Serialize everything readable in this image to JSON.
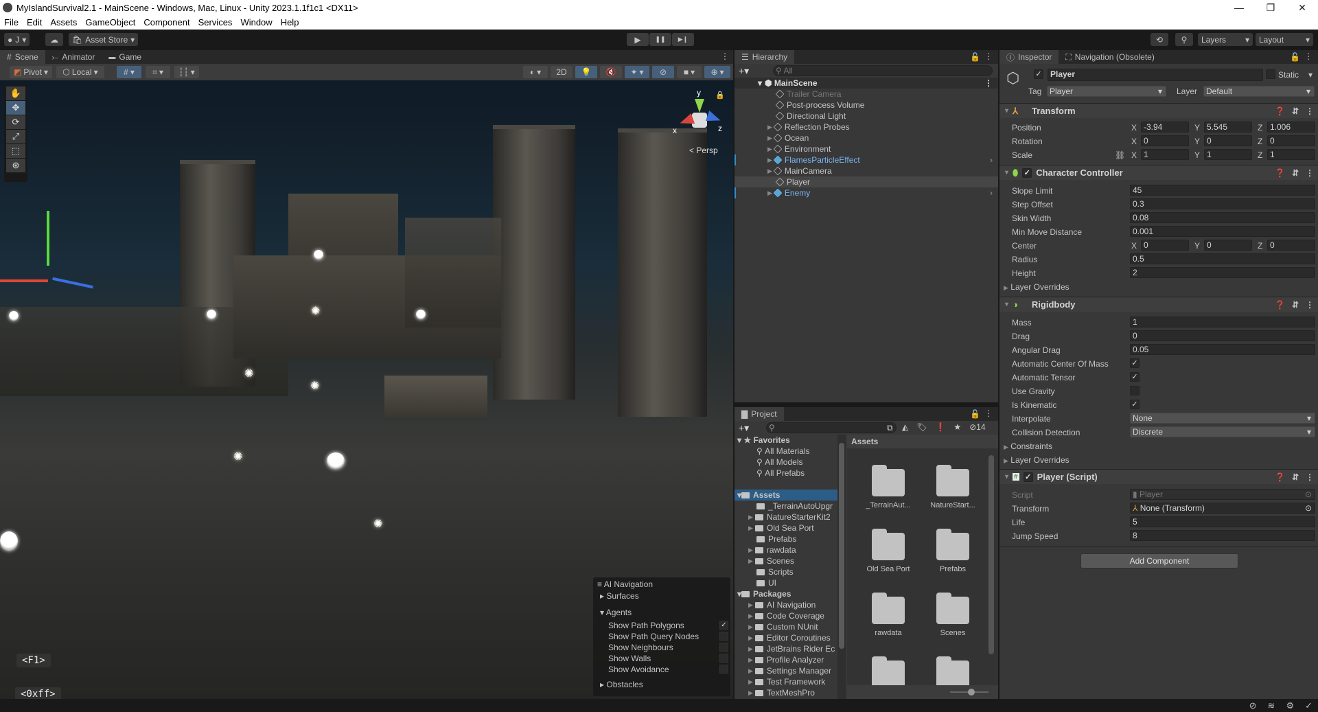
{
  "window": {
    "title": "MyIslandSurvival2.1 - MainScene - Windows, Mac, Linux - Unity 2023.1.1f1c1 <DX11>",
    "controls": {
      "minimize": "—",
      "restore": "❐",
      "close": "✕"
    }
  },
  "menu": [
    "File",
    "Edit",
    "Assets",
    "GameObject",
    "Component",
    "Services",
    "Window",
    "Help"
  ],
  "toolbar": {
    "account": "J",
    "asset_store": "Asset Store",
    "layers": "Layers",
    "layout": "Layout",
    "play_icons": {
      "play": "▶",
      "pause": "❚❚",
      "step": "▶❙"
    }
  },
  "scene_tabs": [
    {
      "label": "Scene",
      "icon": "#",
      "active": true
    },
    {
      "label": "Animator",
      "icon": "⤚",
      "active": false
    },
    {
      "label": "Game",
      "icon": "🎮",
      "active": false
    }
  ],
  "scene_toolbar": {
    "pivot": "Pivot",
    "local": "Local",
    "mode_2d": "2D"
  },
  "gizmo": {
    "y": "y",
    "x": "x",
    "z": "z",
    "projection": "< Persp"
  },
  "shortcut_hints": [
    "<F1>",
    "<0xff>"
  ],
  "ai_navigation": {
    "title": "AI Navigation",
    "surfaces": "Surfaces",
    "agents": "Agents",
    "options": [
      {
        "label": "Show Path Polygons",
        "checked": true
      },
      {
        "label": "Show Path Query Nodes",
        "checked": false
      },
      {
        "label": "Show Neighbours",
        "checked": false
      },
      {
        "label": "Show Walls",
        "checked": false
      },
      {
        "label": "Show Avoidance",
        "checked": false
      }
    ],
    "obstacles": "Obstacles"
  },
  "hierarchy": {
    "tab": "Hierarchy",
    "search_placeholder": "All",
    "scene": "MainScene",
    "items": [
      {
        "name": "Trailer Camera",
        "expandable": false,
        "prefab": false,
        "disabled": true
      },
      {
        "name": "Post-process Volume",
        "expandable": false,
        "prefab": false
      },
      {
        "name": "Directional Light",
        "expandable": false,
        "prefab": false
      },
      {
        "name": "Reflection Probes",
        "expandable": true,
        "prefab": false
      },
      {
        "name": "Ocean",
        "expandable": true,
        "prefab": false
      },
      {
        "name": "Environment",
        "expandable": true,
        "prefab": false
      },
      {
        "name": "FlamesParticleEffect",
        "expandable": true,
        "prefab": true
      },
      {
        "name": "MainCamera",
        "expandable": true,
        "prefab": false
      },
      {
        "name": "Player",
        "expandable": false,
        "prefab": false,
        "selected": true
      },
      {
        "name": "Enemy",
        "expandable": true,
        "prefab": true
      }
    ]
  },
  "project": {
    "tab": "Project",
    "hidden_count": "14",
    "favorites": {
      "label": "Favorites",
      "items": [
        "All Materials",
        "All Models",
        "All Prefabs"
      ]
    },
    "assets": {
      "label": "Assets",
      "items": [
        {
          "name": "_TerrainAutoUpgr",
          "expandable": false
        },
        {
          "name": "NatureStarterKit2",
          "expandable": true
        },
        {
          "name": "Old Sea Port",
          "expandable": true
        },
        {
          "name": "Prefabs",
          "expandable": false
        },
        {
          "name": "rawdata",
          "expandable": true
        },
        {
          "name": "Scenes",
          "expandable": true
        },
        {
          "name": "Scripts",
          "expandable": false
        },
        {
          "name": "UI",
          "expandable": false
        }
      ]
    },
    "packages": {
      "label": "Packages",
      "items": [
        "AI Navigation",
        "Code Coverage",
        "Custom NUnit",
        "Editor Coroutines",
        "JetBrains Rider Ec",
        "Profile Analyzer",
        "Settings Manager",
        "Test Framework",
        "TextMeshPro"
      ]
    },
    "grid_header": "Assets",
    "grid_items": [
      "_TerrainAut...",
      "NatureStart...",
      "Old Sea Port",
      "Prefabs",
      "rawdata",
      "Scenes",
      "",
      ""
    ]
  },
  "inspector": {
    "tabs": [
      "Inspector",
      "Navigation (Obsolete)"
    ],
    "object": {
      "name": "Player",
      "active": true,
      "static_label": "Static",
      "tag_label": "Tag",
      "tag": "Player",
      "layer_label": "Layer",
      "layer": "Default"
    },
    "transform": {
      "title": "Transform",
      "position": {
        "label": "Position",
        "x": "-3.94",
        "y": "5.545",
        "z": "1.006"
      },
      "rotation": {
        "label": "Rotation",
        "x": "0",
        "y": "0",
        "z": "0"
      },
      "scale": {
        "label": "Scale",
        "x": "1",
        "y": "1",
        "z": "1"
      }
    },
    "character_controller": {
      "title": "Character Controller",
      "slope_limit": {
        "label": "Slope Limit",
        "value": "45"
      },
      "step_offset": {
        "label": "Step Offset",
        "value": "0.3"
      },
      "skin_width": {
        "label": "Skin Width",
        "value": "0.08"
      },
      "min_move_distance": {
        "label": "Min Move Distance",
        "value": "0.001"
      },
      "center": {
        "label": "Center",
        "x": "0",
        "y": "0",
        "z": "0"
      },
      "radius": {
        "label": "Radius",
        "value": "0.5"
      },
      "height": {
        "label": "Height",
        "value": "2"
      },
      "layer_overrides": "Layer Overrides"
    },
    "rigidbody": {
      "title": "Rigidbody",
      "mass": {
        "label": "Mass",
        "value": "1"
      },
      "drag": {
        "label": "Drag",
        "value": "0"
      },
      "angular_drag": {
        "label": "Angular Drag",
        "value": "0.05"
      },
      "auto_com": {
        "label": "Automatic Center Of Mass",
        "checked": true
      },
      "auto_tensor": {
        "label": "Automatic Tensor",
        "checked": true
      },
      "use_gravity": {
        "label": "Use Gravity",
        "checked": false
      },
      "is_kinematic": {
        "label": "Is Kinematic",
        "checked": true
      },
      "interpolate": {
        "label": "Interpolate",
        "value": "None"
      },
      "collision": {
        "label": "Collision Detection",
        "value": "Discrete"
      },
      "constraints": "Constraints",
      "layer_overrides": "Layer Overrides"
    },
    "player_script": {
      "title": "Player (Script)",
      "script": {
        "label": "Script",
        "value": "Player"
      },
      "transform": {
        "label": "Transform",
        "value": "None (Transform)"
      },
      "life": {
        "label": "Life",
        "value": "5"
      },
      "jump_speed": {
        "label": "Jump Speed",
        "value": "8"
      }
    },
    "add_component": "Add Component"
  },
  "colors": {
    "accent": "#46607c",
    "selection": "#2c5d87",
    "prefab_text": "#7cb4f0"
  }
}
